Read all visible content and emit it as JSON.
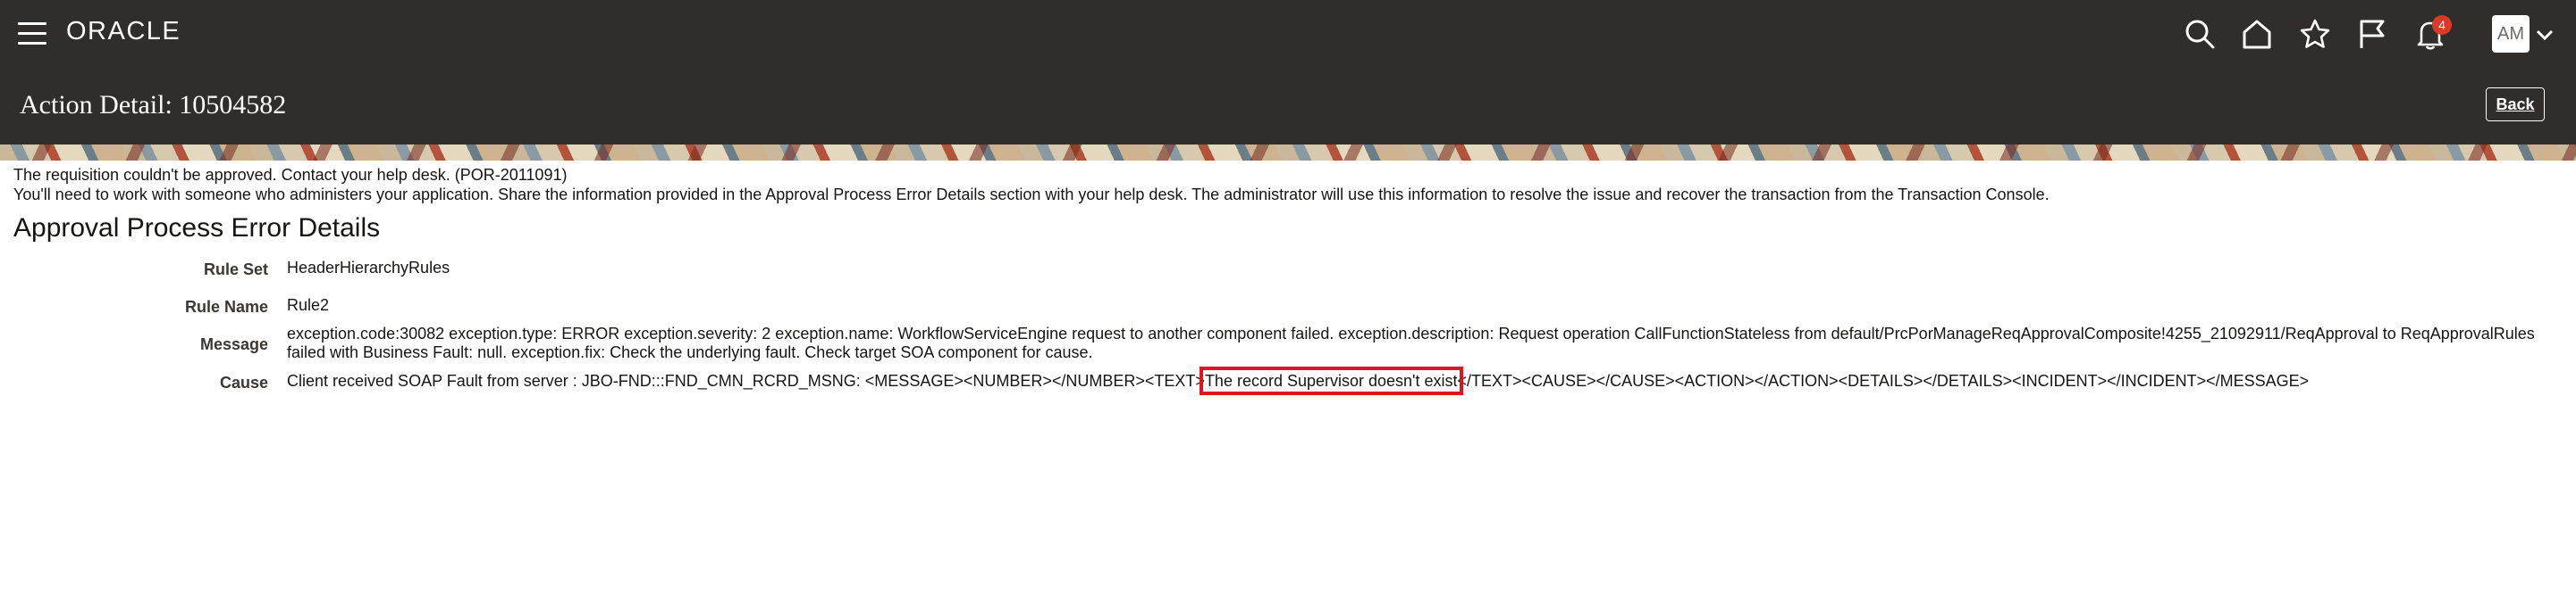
{
  "header": {
    "logo": "ORACLE",
    "notifications_count": "4",
    "avatar_initials": "AM"
  },
  "page": {
    "title": "Action Detail: 10504582",
    "back_label": "Back"
  },
  "messages": {
    "line1": "The requisition couldn't be approved. Contact your help desk. (POR-2011091)",
    "line2": "You'll need to work with someone who administers your application. Share the information provided in the Approval Process Error Details section with your help desk. The administrator will use this information to resolve the issue and recover the transaction from the Transaction Console."
  },
  "details": {
    "section_title": "Approval Process Error Details",
    "rule_set_label": "Rule Set",
    "rule_set_value": "HeaderHierarchyRules",
    "rule_name_label": "Rule Name",
    "rule_name_value": "Rule2",
    "message_label": "Message",
    "message_line1": "exception.code:30082 exception.type: ERROR exception.severity: 2 exception.name: WorkflowServiceEngine request to another component failed. exception.description: Request operation CallFunctionStateless from default/PrcPorManageReqApprovalComposite!4255_21092911/ReqApproval to ReqApprovalRules",
    "message_line2": "failed with Business Fault: null. exception.fix: Check the underlying fault. Check target SOA component for cause.",
    "cause_label": "Cause",
    "cause_prefix": "Client received SOAP Fault from server : JBO-FND:::FND_CMN_RCRD_MSNG: <MESSAGE><NUMBER></NUMBER><TEXT>",
    "cause_highlight": "The record Supervisor doesn't exist",
    "cause_suffix": "</TEXT><CAUSE></CAUSE><ACTION></ACTION><DETAILS></DETAILS><INCIDENT></INCIDENT></MESSAGE>"
  },
  "colors": {
    "header_bg": "#312d2a",
    "badge": "#d63b25",
    "highlight_box": "#e0141e"
  }
}
